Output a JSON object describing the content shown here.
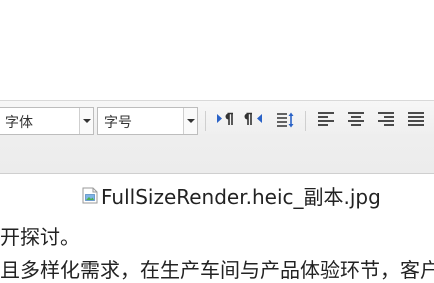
{
  "toolbar": {
    "font_family_value": "字体",
    "font_size_value": "字号",
    "icons": [
      "ltr-direction-icon",
      "rtl-direction-icon",
      "line-spacing-icon",
      "align-left-icon",
      "align-center-icon",
      "align-right-icon",
      "align-justify-icon"
    ]
  },
  "content": {
    "image_alt": "FullSizeRender.heic_副本.jpg",
    "line1": "开探讨。",
    "line2": "且多样化需求，在生产车间与产品体验环节，客户"
  },
  "colors": {
    "icon_blue": "#2b63c7",
    "icon_dark": "#333333"
  }
}
